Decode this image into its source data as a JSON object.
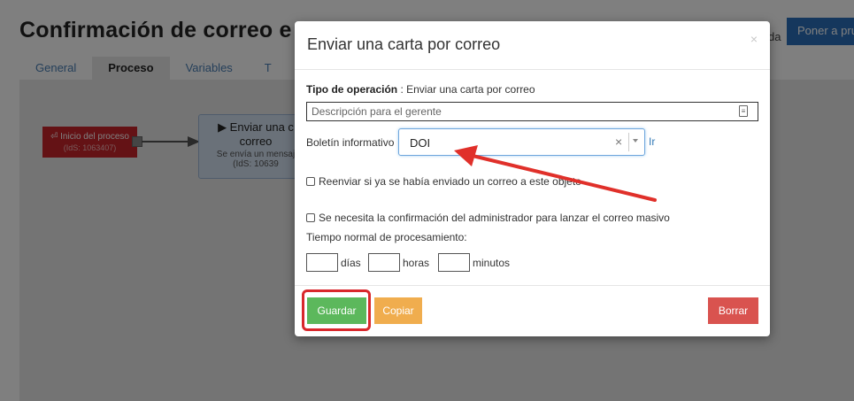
{
  "background": {
    "page_title": "Confirmación de correo e",
    "help_link": "da",
    "test_button": "Poner a pru",
    "tabs": [
      {
        "label": "General"
      },
      {
        "label": "Proceso"
      },
      {
        "label": "Variables"
      },
      {
        "label": "T"
      }
    ],
    "start_node": {
      "label": "⏎ Inicio del proceso",
      "id": "(IdS: 1063407)"
    },
    "action_node": {
      "line1": "▶ Enviar una c",
      "line2": "correo",
      "line3": "Se envía un mensaj",
      "line4": "(IdS: 10639"
    }
  },
  "modal": {
    "title": "Enviar una carta por correo",
    "close_icon": "×",
    "operation_type_label": "Tipo de operación",
    "operation_type_value": " : Enviar una carta por correo",
    "description_placeholder": "Descripción para el gerente",
    "bulletin_label": "Boletín informativo",
    "bulletin_value": "DOI",
    "bulletin_clear": "×",
    "go_link": "Ir",
    "resend_label": "Reenviar si ya se había enviado un correo a este objeto",
    "admin_confirm_label": "Se necesita la confirmación del administrador para lanzar el correo masivo",
    "processing_time_label": "Tiempo normal de procesamiento:",
    "days_label": "días",
    "hours_label": "horas",
    "minutes_label": "minutos",
    "save_button": "Guardar",
    "copy_button": "Copiar",
    "delete_button": "Borrar"
  },
  "colors": {
    "save": "#5cb85c",
    "copy": "#f0ad4e",
    "delete": "#d9534f",
    "annotation": "#d9282c"
  }
}
